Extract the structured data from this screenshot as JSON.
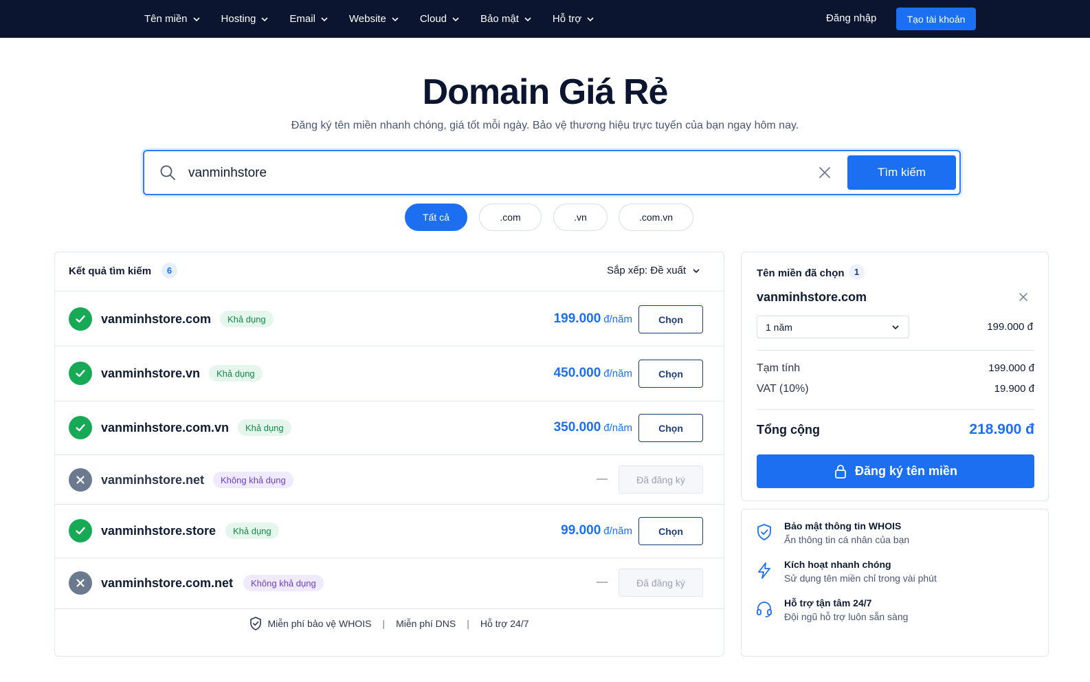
{
  "nav": {
    "menu": [
      {
        "label": "Tên miền",
        "name": "nav-item-domain"
      },
      {
        "label": "Hosting",
        "name": "nav-item-hosting"
      },
      {
        "label": "Email",
        "name": "nav-item-email"
      },
      {
        "label": "Website",
        "name": "nav-item-website"
      },
      {
        "label": "Cloud",
        "name": "nav-item-cloud"
      },
      {
        "label": "Bảo mật",
        "name": "nav-item-security"
      },
      {
        "label": "Hỗ trợ",
        "name": "nav-item-support"
      }
    ],
    "login": "Đăng nhập",
    "signup": "Tạo tài khoản"
  },
  "hero": {
    "title": "Domain Giá Rẻ",
    "subtitle": "Đăng ký tên miền nhanh chóng, giá tốt mỗi ngày. Bảo vệ thương hiệu trực tuyến của bạn ngay hôm nay."
  },
  "search": {
    "value": "vanminhstore",
    "button": "Tìm kiếm"
  },
  "filters": [
    {
      "label": "Tất cả",
      "active": true
    },
    {
      "label": ".com",
      "active": false
    },
    {
      "label": ".vn",
      "active": false
    },
    {
      "label": ".com.vn",
      "active": false
    }
  ],
  "results": {
    "title": "Kết quả tìm kiếm",
    "count": "6",
    "sort": "Sắp xếp: Đề xuất",
    "rows": [
      {
        "domain": "vanminhstore.com",
        "available": true,
        "badge": "Khả dụng",
        "price": "199.000",
        "unit": "đ/năm",
        "action": "Chọn"
      },
      {
        "domain": "vanminhstore.vn",
        "available": true,
        "badge": "Khả dụng",
        "price": "450.000",
        "unit": "đ/năm",
        "action": "Chọn"
      },
      {
        "domain": "vanminhstore.com.vn",
        "available": true,
        "badge": "Khả dụng",
        "price": "350.000",
        "unit": "đ/năm",
        "action": "Chọn"
      },
      {
        "domain": "vanminhstore.net",
        "available": false,
        "badge": "Không khả dụng",
        "price": "—",
        "unit": "",
        "action": "Đã đăng ký"
      },
      {
        "domain": "vanminhstore.store",
        "available": true,
        "badge": "Khả dụng",
        "price": "99.000",
        "unit": "đ/năm",
        "action": "Chọn"
      },
      {
        "domain": "vanminhstore.com.net",
        "available": false,
        "badge": "Không khả dụng",
        "price": "—",
        "unit": "",
        "action": "Đã đăng ký"
      }
    ],
    "footer": [
      "Miễn phí bảo vệ WHOIS",
      "Miễn phí DNS",
      "Hỗ trợ 24/7"
    ]
  },
  "cart": {
    "title": "Tên miền đã chọn",
    "count": "1",
    "domain": "vanminhstore.com",
    "period": "1 năm",
    "item_price": "199.000 đ",
    "subtotal_label": "Tạm tính",
    "subtotal": "199.000 đ",
    "vat_label": "VAT (10%)",
    "vat": "19.900 đ",
    "total_label": "Tổng cộng",
    "total": "218.900 đ",
    "submit": "Đăng ký tên miền"
  },
  "benefits": [
    {
      "title": "Bảo mật thông tin WHOIS",
      "sub": "Ẩn thông tin cá nhân của bạn",
      "icon": "shield-icon"
    },
    {
      "title": "Kích hoạt nhanh chóng",
      "sub": "Sử dụng tên miền chỉ trong vài phút",
      "icon": "lightning-icon"
    },
    {
      "title": "Hỗ trợ tận tâm 24/7",
      "sub": "Đội ngũ hỗ trợ luôn sẵn sàng",
      "icon": "headset-icon"
    }
  ],
  "colors": {
    "nav_bg": "#0b1530",
    "accent": "#1b6ff0",
    "available": "#18a957",
    "unavailable": "#6c7a90"
  }
}
